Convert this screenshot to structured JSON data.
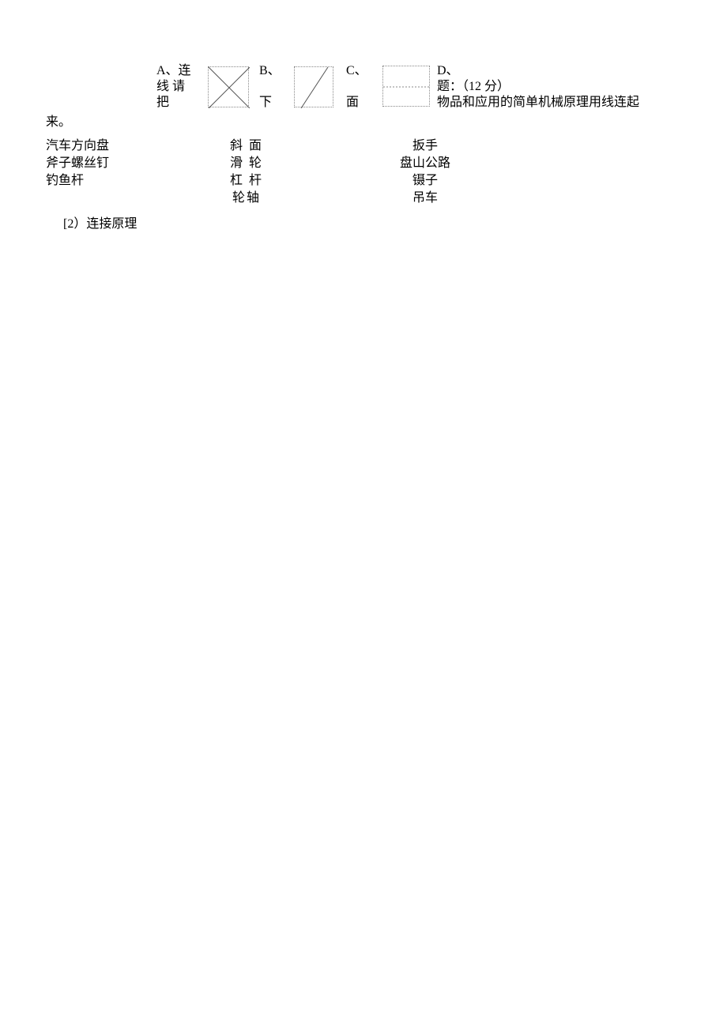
{
  "labels": {
    "a_line1": "A、连",
    "a_line2": "线 请",
    "a_line3": "把",
    "b_line1": "B、",
    "b_line2": "下",
    "c_line1": "C、",
    "c_line2": "面",
    "d_line1": "D、",
    "d_line2": "题：（12 分）",
    "d_line3": "物品和应用的简单机械原理用线连起"
  },
  "continuation": "来。",
  "col_left": {
    "r1": "汽车方向盘",
    "r2": "斧子螺丝钉",
    "r3": "钓鱼杆"
  },
  "col_mid": {
    "r1": "斜 面",
    "r2": "滑 轮",
    "r3": "杠 杆",
    "r4": "轮轴"
  },
  "col_right": {
    "r1": "扳手",
    "r2": "盘山公路",
    "r3": "镊子",
    "r4": "吊车"
  },
  "footer": "[2）连接原理"
}
